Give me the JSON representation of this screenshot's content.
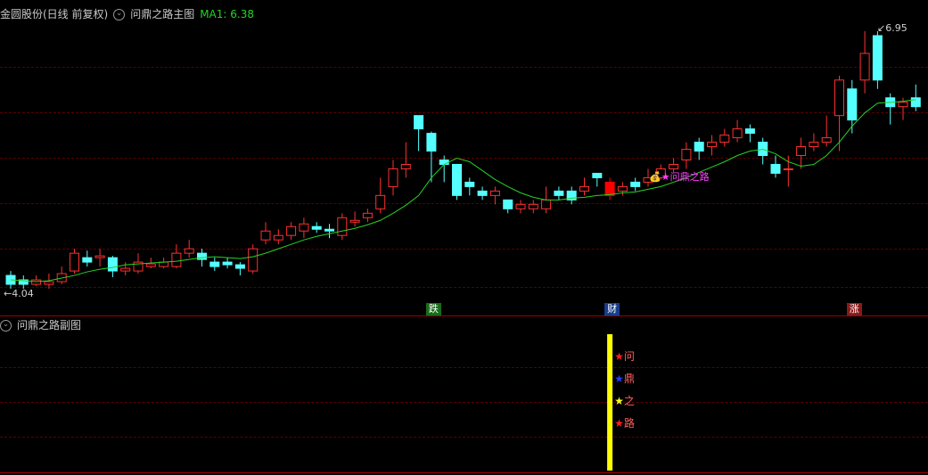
{
  "main_header": {
    "stock": "金圆股份(日线 前复权)",
    "indicator": "问鼎之路主图",
    "ma_label": "MA1: 6.38"
  },
  "sub_header": {
    "indicator": "问鼎之路副图"
  },
  "price_labels": {
    "high": "6.95",
    "low": "4.04"
  },
  "signal_label": "问鼎之路",
  "event_tags": [
    {
      "text": "跌",
      "color": "#1a6b1a"
    },
    {
      "text": "财",
      "color": "#1a3d8a"
    },
    {
      "text": "涨",
      "color": "#8a1a1a"
    }
  ],
  "sub_markers": [
    {
      "char": "问",
      "color": "#ff2020"
    },
    {
      "char": "鼎",
      "color": "#2040ff"
    },
    {
      "char": "之",
      "color": "#ffff20"
    },
    {
      "char": "路",
      "color": "#ff2020"
    }
  ],
  "colors": {
    "up": "#ff3030",
    "down": "#55ffff",
    "ma": "#24d424",
    "signal_bar": "#ffff00",
    "signal_candle": "#ff0000"
  },
  "chart_data": {
    "type": "candlestick",
    "y_range": [
      4.04,
      6.95
    ],
    "candles": [
      [
        4.2,
        4.1,
        4.25,
        4.05
      ],
      [
        4.15,
        4.1,
        4.2,
        4.05
      ],
      [
        4.1,
        4.15,
        4.2,
        4.08
      ],
      [
        4.1,
        4.13,
        4.22,
        4.05
      ],
      [
        4.13,
        4.22,
        4.3,
        4.1
      ],
      [
        4.25,
        4.45,
        4.5,
        4.22
      ],
      [
        4.4,
        4.35,
        4.48,
        4.3
      ],
      [
        4.4,
        4.42,
        4.5,
        4.3
      ],
      [
        4.4,
        4.25,
        4.42,
        4.18
      ],
      [
        4.25,
        4.28,
        4.35,
        4.2
      ],
      [
        4.25,
        4.35,
        4.45,
        4.22
      ],
      [
        4.3,
        4.33,
        4.4,
        4.28
      ],
      [
        4.3,
        4.35,
        4.4,
        4.28
      ],
      [
        4.3,
        4.45,
        4.55,
        4.28
      ],
      [
        4.45,
        4.5,
        4.6,
        4.4
      ],
      [
        4.45,
        4.38,
        4.5,
        4.3
      ],
      [
        4.35,
        4.3,
        4.4,
        4.25
      ],
      [
        4.35,
        4.32,
        4.4,
        4.28
      ],
      [
        4.32,
        4.28,
        4.35,
        4.2
      ],
      [
        4.25,
        4.5,
        4.55,
        4.22
      ],
      [
        4.6,
        4.7,
        4.8,
        4.55
      ],
      [
        4.6,
        4.65,
        4.72,
        4.55
      ],
      [
        4.65,
        4.75,
        4.8,
        4.6
      ],
      [
        4.7,
        4.78,
        4.85,
        4.62
      ],
      [
        4.75,
        4.72,
        4.8,
        4.68
      ],
      [
        4.72,
        4.7,
        4.78,
        4.62
      ],
      [
        4.65,
        4.85,
        4.9,
        4.6
      ],
      [
        4.8,
        4.82,
        4.92,
        4.75
      ],
      [
        4.85,
        4.9,
        4.95,
        4.8
      ],
      [
        4.95,
        5.1,
        5.3,
        4.9
      ],
      [
        5.2,
        5.4,
        5.5,
        5.1
      ],
      [
        5.4,
        5.45,
        5.7,
        5.3
      ],
      [
        6.0,
        5.85,
        6.0,
        5.6
      ],
      [
        5.8,
        5.6,
        5.82,
        5.25
      ],
      [
        5.5,
        5.45,
        5.55,
        5.25
      ],
      [
        5.45,
        5.1,
        5.45,
        5.05
      ],
      [
        5.25,
        5.2,
        5.3,
        5.1
      ],
      [
        5.15,
        5.1,
        5.2,
        5.05
      ],
      [
        5.1,
        5.15,
        5.2,
        5.0
      ],
      [
        5.05,
        4.95,
        5.05,
        4.9
      ],
      [
        4.95,
        5.0,
        5.05,
        4.9
      ],
      [
        4.95,
        5.0,
        5.05,
        4.9
      ],
      [
        4.95,
        5.05,
        5.2,
        4.9
      ],
      [
        5.15,
        5.1,
        5.2,
        5.05
      ],
      [
        5.15,
        5.05,
        5.2,
        5.0
      ],
      [
        5.15,
        5.2,
        5.3,
        5.1
      ],
      [
        5.35,
        5.3,
        5.35,
        5.2
      ],
      [
        5.25,
        5.1,
        5.3,
        5.05
      ],
      [
        5.15,
        5.2,
        5.25,
        5.1
      ],
      [
        5.25,
        5.2,
        5.3,
        5.15
      ],
      [
        5.25,
        5.3,
        5.4,
        5.2
      ],
      [
        5.3,
        5.4,
        5.45,
        5.28
      ],
      [
        5.4,
        5.45,
        5.52,
        5.35
      ],
      [
        5.5,
        5.62,
        5.7,
        5.4
      ],
      [
        5.7,
        5.6,
        5.75,
        5.5
      ],
      [
        5.65,
        5.7,
        5.78,
        5.55
      ],
      [
        5.7,
        5.78,
        5.85,
        5.65
      ],
      [
        5.75,
        5.85,
        5.95,
        5.7
      ],
      [
        5.85,
        5.8,
        5.9,
        5.7
      ],
      [
        5.7,
        5.55,
        5.75,
        5.45
      ],
      [
        5.45,
        5.35,
        5.55,
        5.3
      ],
      [
        5.4,
        5.4,
        5.55,
        5.2
      ],
      [
        5.55,
        5.65,
        5.75,
        5.4
      ],
      [
        5.65,
        5.7,
        5.8,
        5.6
      ],
      [
        5.7,
        5.75,
        6.0,
        5.65
      ],
      [
        6.0,
        6.4,
        6.45,
        5.6
      ],
      [
        6.3,
        5.95,
        6.4,
        5.8
      ],
      [
        6.4,
        6.7,
        6.95,
        6.25
      ],
      [
        6.9,
        6.4,
        6.95,
        6.3
      ],
      [
        6.2,
        6.1,
        6.25,
        5.9
      ],
      [
        6.1,
        6.15,
        6.2,
        5.95
      ],
      [
        6.2,
        6.1,
        6.35,
        6.05
      ]
    ],
    "ma_values": [
      4.15,
      4.14,
      4.13,
      4.14,
      4.17,
      4.2,
      4.24,
      4.27,
      4.29,
      4.32,
      4.33,
      4.34,
      4.35,
      4.36,
      4.38,
      4.4,
      4.41,
      4.4,
      4.39,
      4.41,
      4.45,
      4.5,
      4.55,
      4.6,
      4.64,
      4.67,
      4.7,
      4.73,
      4.77,
      4.82,
      4.9,
      4.99,
      5.1,
      5.3,
      5.45,
      5.52,
      5.48,
      5.38,
      5.28,
      5.2,
      5.13,
      5.08,
      5.05,
      5.05,
      5.07,
      5.08,
      5.1,
      5.11,
      5.13,
      5.14,
      5.17,
      5.2,
      5.25,
      5.3,
      5.36,
      5.42,
      5.48,
      5.55,
      5.6,
      5.62,
      5.57,
      5.48,
      5.43,
      5.45,
      5.55,
      5.7,
      5.88,
      6.03,
      6.14,
      6.15,
      6.16,
      6.18
    ],
    "signal_index": 47,
    "event_indices": [
      33,
      47,
      66
    ]
  }
}
